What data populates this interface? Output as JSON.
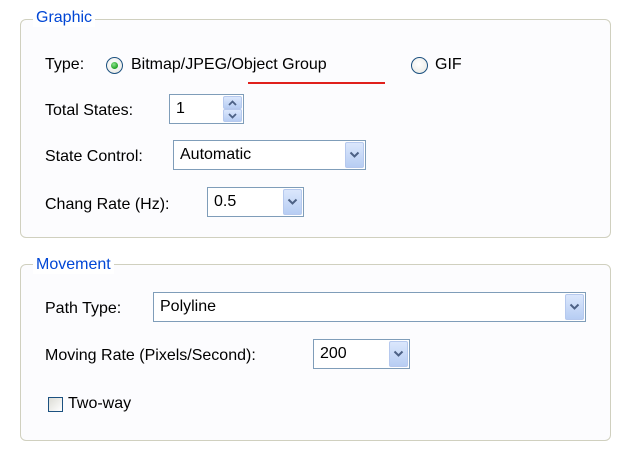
{
  "graphic": {
    "legend": "Graphic",
    "type_label": "Type:",
    "type_options": [
      {
        "label": "Bitmap/JPEG/Object Group",
        "selected": true
      },
      {
        "label": "GIF",
        "selected": false
      }
    ],
    "total_states_label": "Total States:",
    "total_states_value": "1",
    "state_control_label": "State Control:",
    "state_control_value": "Automatic",
    "change_rate_label": "Chang Rate (Hz):",
    "change_rate_value": "0.5"
  },
  "movement": {
    "legend": "Movement",
    "path_type_label": "Path Type:",
    "path_type_value": "Polyline",
    "moving_rate_label": "Moving Rate (Pixels/Second):",
    "moving_rate_value": "200",
    "two_way_label": "Two-way",
    "two_way_checked": false
  },
  "colors": {
    "legend_text": "#0046d5",
    "annotation_underline": "#e0201c",
    "radio_selected": "#21a121"
  },
  "icons": {
    "dropdown": "chevron-down-icon",
    "spin_up": "spin-up-icon",
    "spin_down": "spin-down-icon",
    "radio": "radio-icon",
    "checkbox": "checkbox-icon"
  }
}
